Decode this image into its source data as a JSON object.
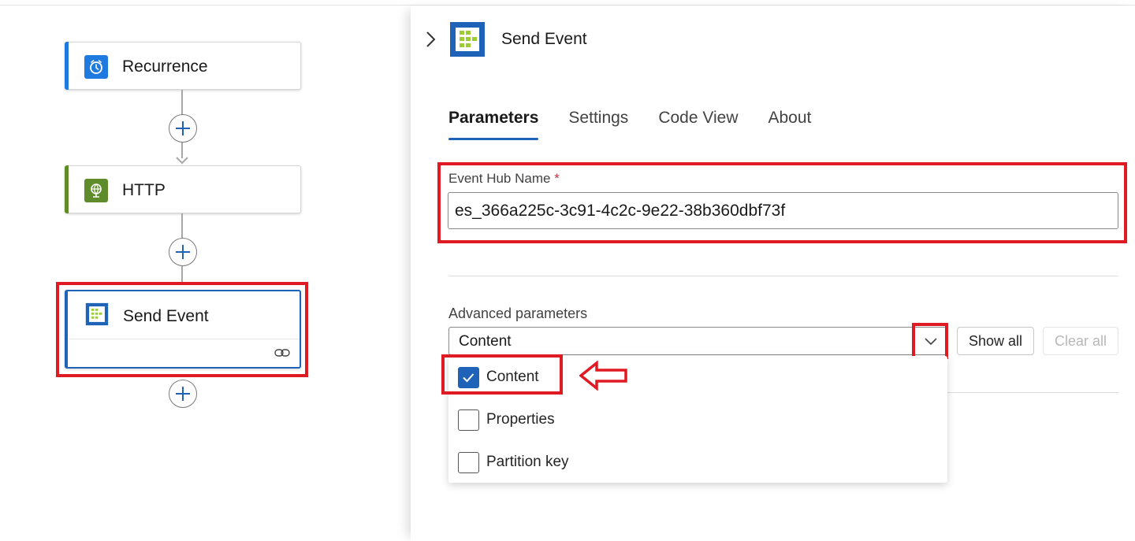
{
  "canvas": {
    "nodes": [
      {
        "title": "Recurrence",
        "icon": "alarm-clock-icon",
        "accent": "#1f7ae0"
      },
      {
        "title": "HTTP",
        "icon": "globe-icon",
        "accent": "#5f8c2a"
      },
      {
        "title": "Send Event",
        "icon": "event-hubs-icon",
        "link_icon": "link-icon"
      }
    ]
  },
  "panel": {
    "title": "Send Event",
    "icon": "event-hubs-icon",
    "tabs": [
      {
        "label": "Parameters",
        "active": true
      },
      {
        "label": "Settings",
        "active": false
      },
      {
        "label": "Code View",
        "active": false
      },
      {
        "label": "About",
        "active": false
      }
    ],
    "event_hub": {
      "label": "Event Hub Name",
      "required_marker": "*",
      "value": "es_366a225c-3c91-4c2c-9e22-38b360dbf73f"
    },
    "advanced": {
      "label": "Advanced parameters",
      "selected": "Content",
      "show_all_label": "Show all",
      "clear_all_label": "Clear all",
      "options": [
        {
          "label": "Content",
          "checked": true
        },
        {
          "label": "Properties",
          "checked": false
        },
        {
          "label": "Partition key",
          "checked": false
        }
      ]
    }
  },
  "colors": {
    "highlight": "#e01a22",
    "accent_blue": "#1f63b8"
  }
}
